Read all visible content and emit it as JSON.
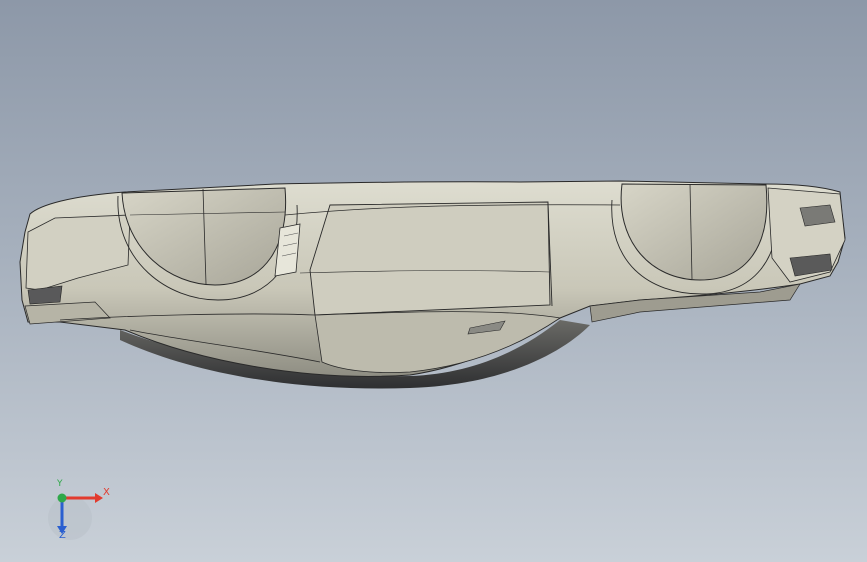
{
  "viewport": {
    "background_top": "#8d98a8",
    "background_bottom": "#c9d0d8"
  },
  "model": {
    "body_color": "#c8c6b8",
    "shadow_color": "#3e3f42",
    "edge_color": "#2a2a2a"
  },
  "triad": {
    "x_label": "X",
    "y_label": "Y",
    "z_label": "Z",
    "x_color": "#e23b2e",
    "y_color": "#2fa84a",
    "z_color": "#2a5fd0"
  }
}
